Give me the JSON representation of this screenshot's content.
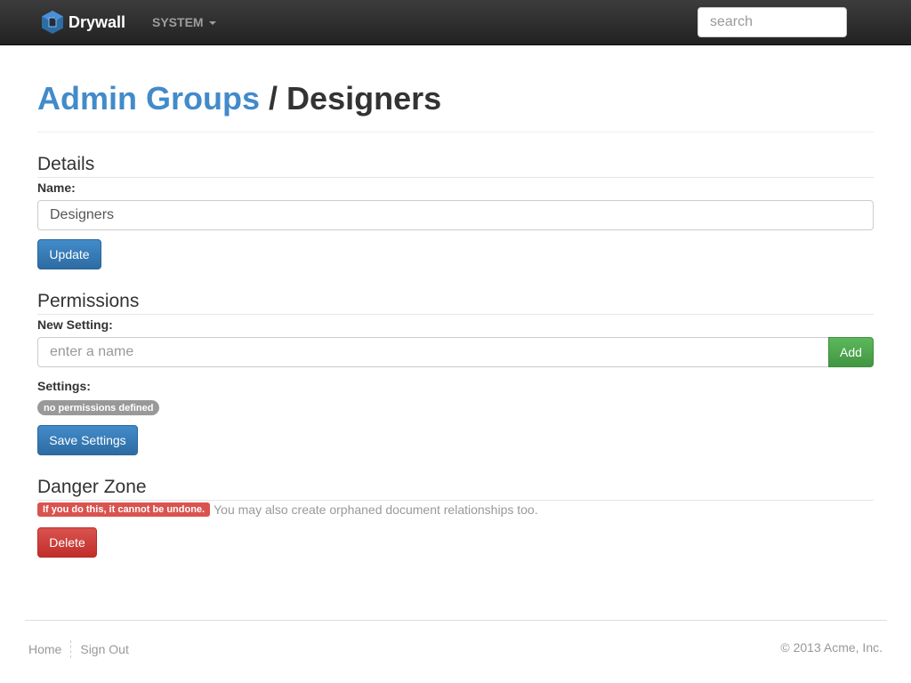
{
  "navbar": {
    "brand": "Drywall",
    "brand_icon": "drywall-logo-icon",
    "system_menu": "SYSTEM",
    "search_placeholder": "search"
  },
  "page": {
    "breadcrumb_parent": "Admin Groups",
    "breadcrumb_separator": "/",
    "current": "Designers"
  },
  "details": {
    "title": "Details",
    "name_label": "Name:",
    "name_value": "Designers",
    "update_button": "Update"
  },
  "permissions": {
    "title": "Permissions",
    "new_setting_label": "New Setting:",
    "new_setting_placeholder": "enter a name",
    "add_button": "Add",
    "settings_label": "Settings:",
    "empty_badge": "no permissions defined",
    "save_button": "Save Settings"
  },
  "danger": {
    "title": "Danger Zone",
    "warning_label": "If you do this, it cannot be undone.",
    "warning_text": "You may also create orphaned document relationships too.",
    "delete_button": "Delete"
  },
  "footer": {
    "home": "Home",
    "sign_out": "Sign Out",
    "copyright": "© 2013 Acme, Inc."
  },
  "colors": {
    "link": "#428bca",
    "primary": "#428bca",
    "success": "#5cb85c",
    "danger": "#d9534f",
    "navbar": "#222222"
  }
}
